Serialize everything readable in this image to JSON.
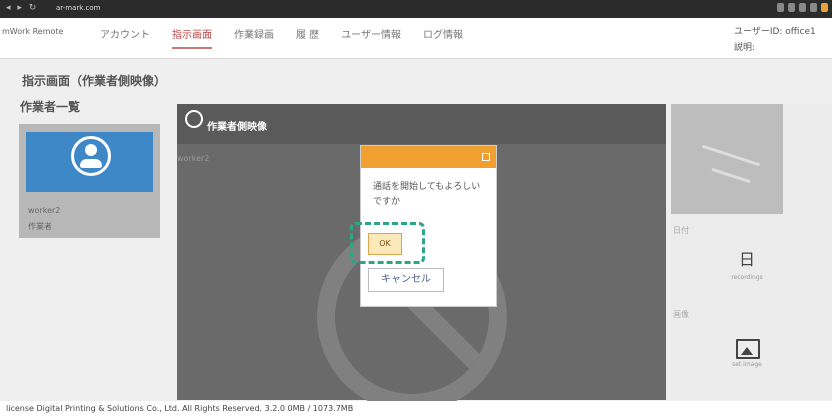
{
  "browser": {
    "url": "ar-mark.com"
  },
  "header": {
    "logo": "mWork Remote",
    "menu": [
      "アカウント",
      "指示画面",
      "作業録画",
      "履 歴",
      "ユーザー情報",
      "ログ情報"
    ],
    "active_index": 1,
    "user_label": "ユーザーID: office1",
    "desc_label": "説明:"
  },
  "page": {
    "title": "指示画面（作業者側映像）",
    "workers_title": "作業者一覧"
  },
  "worker": {
    "name": "worker2",
    "status": "作業者"
  },
  "video": {
    "title": "作業者側映像",
    "name": "worker2"
  },
  "dialog": {
    "message": "通話を開始してもよろしいですか",
    "ok": "OK",
    "cancel": "キャンセル"
  },
  "side": {
    "label_calendar": "日付",
    "calendar_caption": "recordings",
    "label_images": "画像",
    "image_caption": "set image"
  },
  "footer": {
    "text": "license  Digital Printing & Solutions Co., Ltd. All Rights Reserved. 3.2.0   0MB / 1073.7MB"
  },
  "colors": {
    "accent": "#f0a030",
    "highlight": "#2aa787",
    "thumb": "#3f88c7"
  }
}
